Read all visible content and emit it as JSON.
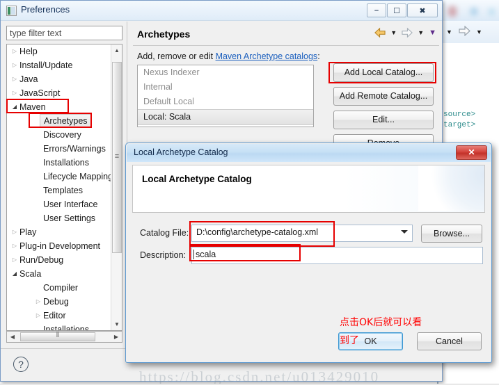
{
  "window": {
    "title": "Preferences",
    "icon": "preferences-icon",
    "controls": {
      "minimize": "—",
      "maximize": "❐",
      "close": "✕"
    }
  },
  "filter": {
    "placeholder": "type filter text",
    "value": ""
  },
  "tree": {
    "items": [
      {
        "label": "Help",
        "indent": 0,
        "twisty": "collapsed"
      },
      {
        "label": "Install/Update",
        "indent": 0,
        "twisty": "collapsed"
      },
      {
        "label": "Java",
        "indent": 0,
        "twisty": "collapsed"
      },
      {
        "label": "JavaScript",
        "indent": 0,
        "twisty": "collapsed"
      },
      {
        "label": "Maven",
        "indent": 0,
        "twisty": "expanded"
      },
      {
        "label": "Archetypes",
        "indent": 1,
        "twisty": "none",
        "selected": true
      },
      {
        "label": "Discovery",
        "indent": 1,
        "twisty": "none"
      },
      {
        "label": "Errors/Warnings",
        "indent": 1,
        "twisty": "none"
      },
      {
        "label": "Installations",
        "indent": 1,
        "twisty": "none"
      },
      {
        "label": "Lifecycle Mapping",
        "indent": 1,
        "twisty": "none"
      },
      {
        "label": "Templates",
        "indent": 1,
        "twisty": "none"
      },
      {
        "label": "User Interface",
        "indent": 1,
        "twisty": "none"
      },
      {
        "label": "User Settings",
        "indent": 1,
        "twisty": "none"
      },
      {
        "label": "Play",
        "indent": 0,
        "twisty": "collapsed"
      },
      {
        "label": "Plug-in Development",
        "indent": 0,
        "twisty": "collapsed"
      },
      {
        "label": "Run/Debug",
        "indent": 0,
        "twisty": "collapsed"
      },
      {
        "label": "Scala",
        "indent": 0,
        "twisty": "expanded"
      },
      {
        "label": "Compiler",
        "indent": 1,
        "twisty": "none"
      },
      {
        "label": "Debug",
        "indent": 1,
        "twisty": "collapsed"
      },
      {
        "label": "Editor",
        "indent": 1,
        "twisty": "collapsed"
      },
      {
        "label": "Installations",
        "indent": 1,
        "twisty": "none"
      }
    ]
  },
  "panel": {
    "title": "Archetypes",
    "description_prefix": "Add, remove or edit ",
    "description_link": "Maven Archetype catalogs",
    "description_suffix": ":",
    "catalogs": [
      {
        "label": "Nexus Indexer",
        "selected": false
      },
      {
        "label": "Internal",
        "selected": false
      },
      {
        "label": "Default Local",
        "selected": false
      },
      {
        "label": "Local: Scala",
        "selected": true
      }
    ],
    "buttons": [
      "Add Local Catalog...",
      "Add Remote Catalog...",
      "Edit...",
      "Remove"
    ],
    "toolbar": {
      "back_icon": "back-arrow-icon",
      "back_menu_icon": "chevron-down-icon",
      "forward_icon": "forward-arrow-icon",
      "forward_menu_icon": "chevron-down-icon",
      "view_menu_icon": "chevron-down-icon"
    },
    "help_icon": "help-question-icon"
  },
  "dialog": {
    "title": "Local Archetype Catalog",
    "close_label": "✕",
    "header_title": "Local Archetype Catalog",
    "fields": [
      {
        "name": "catalog-file",
        "label": "Catalog File:",
        "value": "D:\\config\\archetype-catalog.xml",
        "type": "combo"
      },
      {
        "name": "description",
        "label": "Description:",
        "value": "scala",
        "type": "text"
      }
    ],
    "browse_label": "Browse...",
    "ok_label": "OK",
    "cancel_label": "Cancel"
  },
  "annotation": {
    "line1": "点击OK后就可以看",
    "line2": "到了",
    "color": "#ff0000"
  },
  "background": {
    "code_line_1": "source>",
    "code_line_2": "target>"
  },
  "watermark": "https://blog.csdn.net/u013429010"
}
